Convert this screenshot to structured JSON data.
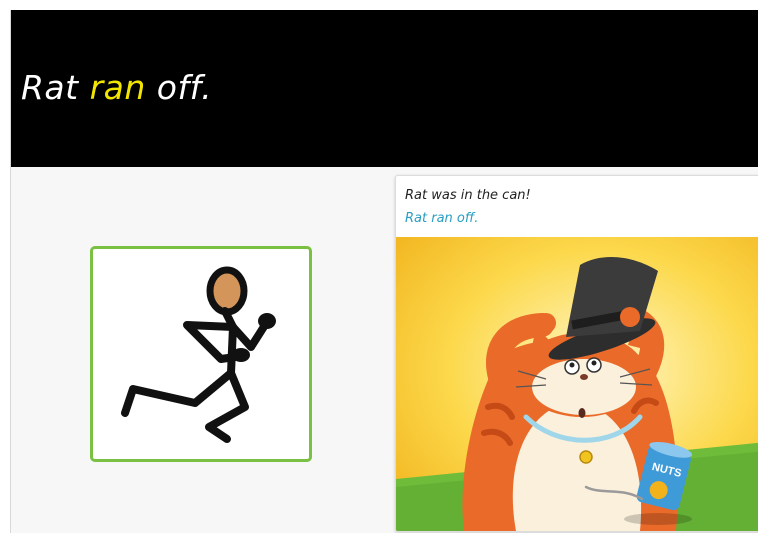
{
  "slide": {
    "title_parts": [
      "Rat ",
      "ran",
      " off."
    ]
  },
  "symbol": {
    "icon": "running-person-icon",
    "border_color": "#7ac143"
  },
  "book": {
    "line1": "Rat was in the can!",
    "line2": "Rat ran off.",
    "line2_color": "#2a9ec2",
    "illustration_label": "NUTS"
  },
  "colors": {
    "header_bg": "#000000",
    "title_text": "#ffffff",
    "title_highlight": "#f2e600"
  }
}
